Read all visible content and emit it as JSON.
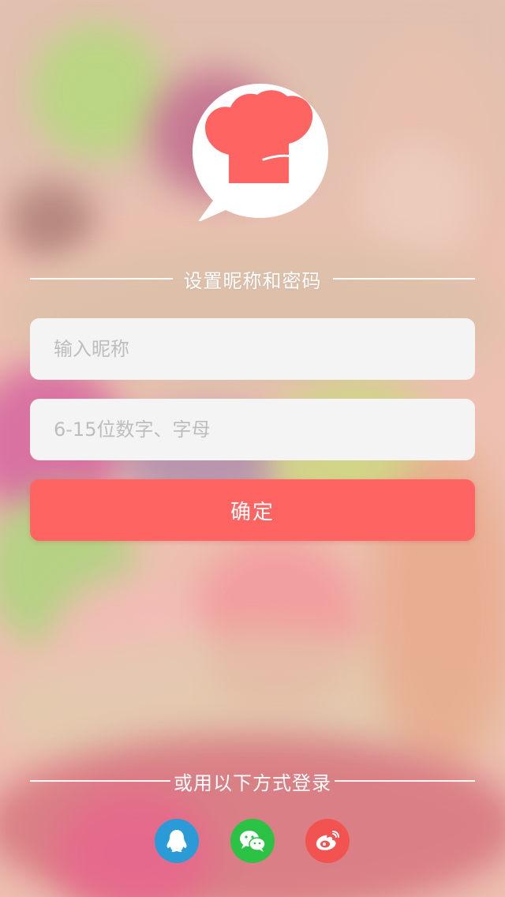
{
  "header": {
    "title": "设置昵称和密码"
  },
  "form": {
    "nickname_placeholder": "输入昵称",
    "password_placeholder": "6-15位数字、字母",
    "confirm_label": "确定"
  },
  "social_login": {
    "title": "或用以下方式登录",
    "providers": [
      {
        "name": "qq",
        "icon": "qq-icon",
        "color": "#2b9bd8"
      },
      {
        "name": "wechat",
        "icon": "wechat-icon",
        "color": "#2cc245"
      },
      {
        "name": "weibo",
        "icon": "weibo-icon",
        "color": "#f25350"
      }
    ]
  },
  "colors": {
    "accent": "#fe6462",
    "input_background": "#f4f4f4"
  }
}
